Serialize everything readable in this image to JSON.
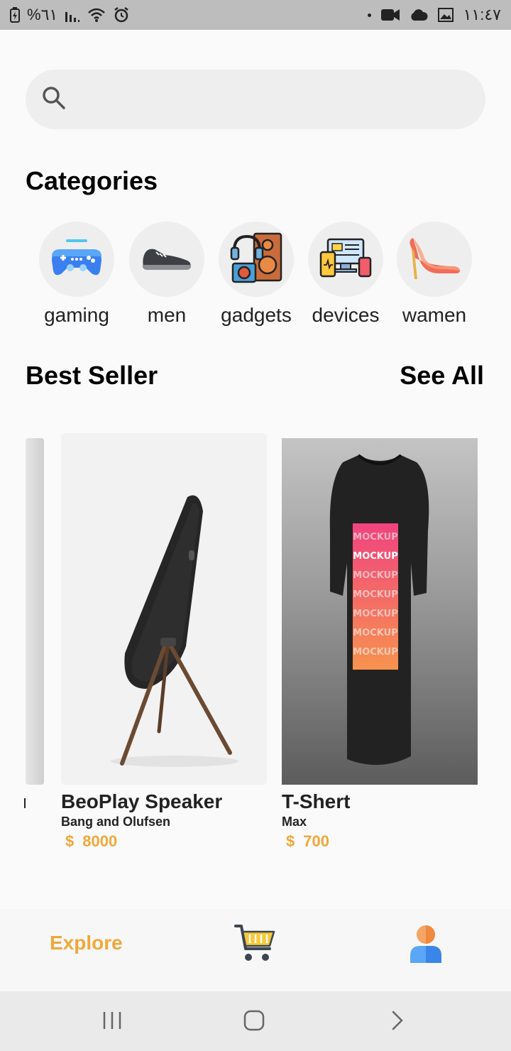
{
  "status_bar": {
    "battery_text": "%٦١",
    "time": "١١:٤٧"
  },
  "search": {
    "placeholder": "",
    "value": ""
  },
  "categories": {
    "title": "Categories",
    "items": [
      {
        "label": "gaming",
        "icon": "gamepad-icon"
      },
      {
        "label": "men",
        "icon": "sneaker-icon"
      },
      {
        "label": "gadgets",
        "icon": "gadgets-icon"
      },
      {
        "label": "devices",
        "icon": "devices-icon"
      },
      {
        "label": "wamen",
        "icon": "high-heel-icon"
      }
    ]
  },
  "best_seller": {
    "title": "Best Seller",
    "see_all": "See All",
    "products": [
      {
        "name": "BeoPlay Speaker",
        "brand": "Bang and Olufsen",
        "currency": "$",
        "price": "8000"
      },
      {
        "name": "T-Shert",
        "brand": "Max",
        "currency": "$",
        "price": "700"
      }
    ]
  },
  "tshirt_print": {
    "lines": [
      "MOCKUP",
      "MOCKUP",
      "MOCKUP",
      "MOCKUP",
      "MOCKUP",
      "MOCKUP",
      "MOCKUP"
    ]
  },
  "bottom_nav": {
    "explore": "Explore",
    "cart_icon": "cart-icon",
    "profile_icon": "profile-icon"
  },
  "colors": {
    "accent": "#f0a83a",
    "background": "#fafafa",
    "search_bg": "#eeeeee"
  }
}
